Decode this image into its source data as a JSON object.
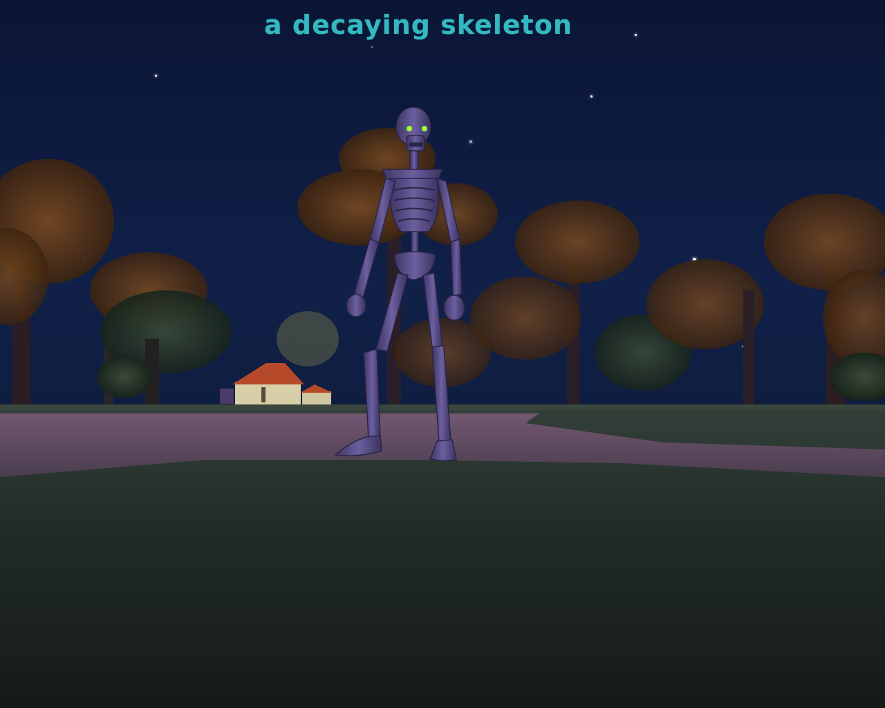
{
  "target": {
    "name": "a decaying skeleton"
  },
  "colors": {
    "nameplate": "#36b8c2",
    "sky": "#0c1838",
    "foliage": "#6b3f1a",
    "ground_path": "#6d5168",
    "ground_grass": "#1e2a22",
    "skeleton_bone": "#5a4f88",
    "skeleton_eyes": "#9cff3a"
  }
}
